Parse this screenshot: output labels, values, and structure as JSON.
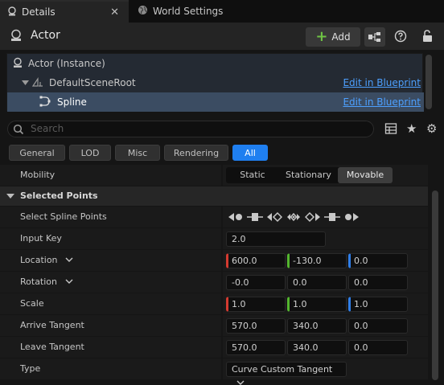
{
  "tabs": {
    "details_label": "Details",
    "world_settings_label": "World Settings"
  },
  "header": {
    "title": "Actor",
    "add_label": "Add"
  },
  "tree": {
    "rows": [
      {
        "label": "Actor (Instance)",
        "edit": ""
      },
      {
        "label": "DefaultSceneRoot",
        "edit": "Edit in Blueprint"
      },
      {
        "label": "Spline",
        "edit": "Edit in Blueprint"
      }
    ]
  },
  "search": {
    "placeholder": "Search"
  },
  "filters": {
    "general": "General",
    "lod": "LOD",
    "misc": "Misc",
    "rendering": "Rendering",
    "all": "All"
  },
  "mobility": {
    "label": "Mobility",
    "options": [
      "Static",
      "Stationary",
      "Movable"
    ],
    "selected": "Movable"
  },
  "section": {
    "title": "Selected Points"
  },
  "properties": {
    "select_spline_points": "Select Spline Points",
    "input_key": {
      "label": "Input Key",
      "value": "2.0"
    },
    "location": {
      "label": "Location",
      "x": "600.0",
      "y": "-130.0",
      "z": "0.0"
    },
    "rotation": {
      "label": "Rotation",
      "x": "-0.0",
      "y": "0.0",
      "z": "0.0"
    },
    "scale": {
      "label": "Scale",
      "x": "1.0",
      "y": "1.0",
      "z": "1.0"
    },
    "arrive_tangent": {
      "label": "Arrive Tangent",
      "x": "570.0",
      "y": "340.0",
      "z": "0.0"
    },
    "leave_tangent": {
      "label": "Leave Tangent",
      "x": "570.0",
      "y": "340.0",
      "z": "0.0"
    },
    "type": {
      "label": "Type",
      "value": "Curve Custom Tangent"
    }
  },
  "icons": {
    "tab_details": "details-icon",
    "tab_world": "globe-icon",
    "actor": "actor-icon",
    "hierarchy": "hierarchy-icon",
    "help": "help-icon",
    "lock": "lock-icon",
    "search": "search-icon",
    "grid": "grid-icon",
    "star": "star-icon",
    "gear": "gear-icon"
  }
}
